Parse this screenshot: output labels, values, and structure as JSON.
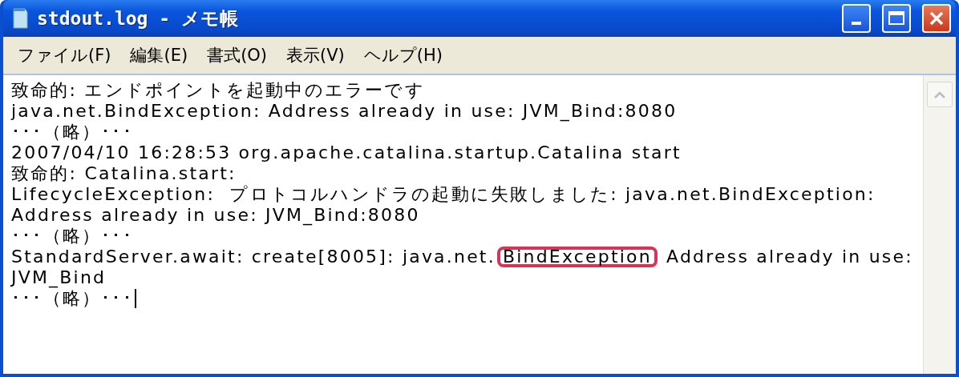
{
  "window": {
    "title": "stdout.log - メモ帳"
  },
  "menu": [
    {
      "label": "ファイル(F)"
    },
    {
      "label": "編集(E)"
    },
    {
      "label": "書式(O)"
    },
    {
      "label": "表示(V)"
    },
    {
      "label": "ヘルプ(H)"
    }
  ],
  "lines": [
    {
      "text": "致命的: エンドポイントを起動中のエラーです"
    },
    {
      "text": "java.net.BindException: Address already in use: JVM_Bind:8080"
    },
    {
      "text": "･･･（略）･･･"
    },
    {
      "text": "2007/04/10 16:28:53 org.apache.catalina.startup.Catalina start"
    },
    {
      "text": "致命的: Catalina.start:"
    },
    {
      "text": "LifecycleException:  プロトコルハンドラの起動に失敗しました: java.net.BindException:"
    },
    {
      "text": "Address already in use: JVM_Bind:8080"
    },
    {
      "text": "･･･（略）･･･"
    },
    {
      "text": "StandardServer.await: create[8005]: java.net.",
      "highlight": "BindException",
      "after": " Address already in use:"
    },
    {
      "text": "JVM_Bind"
    },
    {
      "text": "･･･（略）･･･",
      "cursor": true
    }
  ]
}
